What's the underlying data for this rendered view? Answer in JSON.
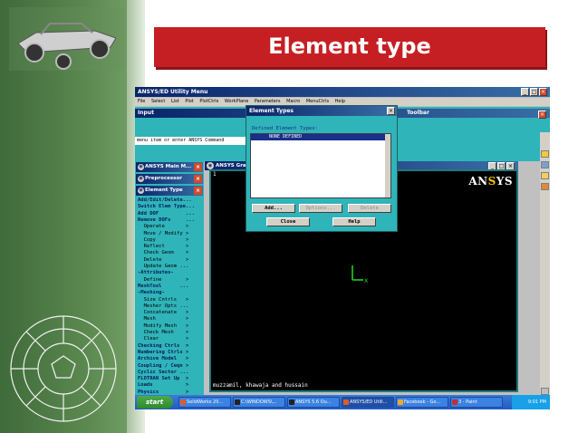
{
  "slide": {
    "title": "Element type",
    "accent": "#c61f23"
  },
  "utility_window": {
    "title": "ANSYS/ED Utility Menu",
    "menu": [
      "File",
      "Select",
      "List",
      "Plot",
      "PlotCtrls",
      "WorkPlane",
      "Parameters",
      "Macro",
      "MenuCtrls",
      "Help"
    ],
    "input_title": "Input",
    "command_prompt": "menu item or enter ANSYS Command",
    "toolbar_title": "Toolbar"
  },
  "main_menu": {
    "title": "ANSYS Main M...",
    "preprocessor_title": "Preprocessor",
    "element_type_title": "Element Type",
    "items": [
      {
        "text": "Add/Edit/Delete...",
        "bold": true
      },
      {
        "text": "Switch Elem Type...",
        "bold": true
      },
      {
        "text": "Add DOF         ...",
        "bold": true
      },
      {
        "text": "Remove DOFs     ...",
        "bold": true
      },
      {
        "text": "  Operate       >",
        "bold": false
      },
      {
        "text": "  Move / Modify >",
        "bold": false
      },
      {
        "text": "  Copy          >",
        "bold": false
      },
      {
        "text": "  Reflect       >",
        "bold": false
      },
      {
        "text": "  Check Geom    >",
        "bold": false
      },
      {
        "text": "  Delete        >",
        "bold": false
      },
      {
        "text": "  Update Geom ...",
        "bold": false
      },
      {
        "text": "-Attributes-",
        "bold": true
      },
      {
        "text": "  Define        >",
        "bold": false
      },
      {
        "text": "MeshTool      ...",
        "bold": true
      },
      {
        "text": "-Meshing-",
        "bold": true
      },
      {
        "text": "  Size Cntrls   >",
        "bold": false
      },
      {
        "text": "  Mesher Opts ...",
        "bold": false
      },
      {
        "text": "  Concatenate   >",
        "bold": false
      },
      {
        "text": "  Mesh          >",
        "bold": false
      },
      {
        "text": "  Modify Mesh   >",
        "bold": false
      },
      {
        "text": "  Check Mesh    >",
        "bold": false
      },
      {
        "text": "  Clear         >",
        "bold": false
      },
      {
        "text": "Checking Ctrls  >",
        "bold": true
      },
      {
        "text": "Numbering Ctrls >",
        "bold": true
      },
      {
        "text": "Archive Model   >",
        "bold": true
      },
      {
        "text": "Coupling / Ceqn >",
        "bold": true
      },
      {
        "text": "Cyclic Sector ...",
        "bold": true
      },
      {
        "text": "FLOTRAN Set Up  >",
        "bold": true
      },
      {
        "text": "Loads           >",
        "bold": true
      },
      {
        "text": "Physics         >",
        "bold": true
      }
    ]
  },
  "graphics": {
    "title": "ANSYS Graphics",
    "window_number": "1",
    "logo_main": "AN",
    "logo_accent": "S",
    "logo_tail": "YS",
    "footer": "muzzamil, khawaja and hussain",
    "axis_label": "X"
  },
  "dialog": {
    "title": "Element Types",
    "label": "Defined Element Types:",
    "list_selected": "NONE DEFINED",
    "buttons": {
      "add": "Add...",
      "options": "Options...",
      "delete": "Delete",
      "close": "Close",
      "help": "Help"
    }
  },
  "taskbar": {
    "start": "start",
    "items": [
      {
        "label": "SolidWorks 20...",
        "active": false
      },
      {
        "label": "C:\\WINDOWS\\...",
        "active": false
      },
      {
        "label": "ANSYS 5.6 Ou...",
        "active": false
      },
      {
        "label": "ANSYS/ED Utili...",
        "active": true
      },
      {
        "label": "Facebook - Go...",
        "active": false
      },
      {
        "label": "3 - Paint",
        "active": false
      }
    ],
    "clock": "9:01 PM"
  }
}
